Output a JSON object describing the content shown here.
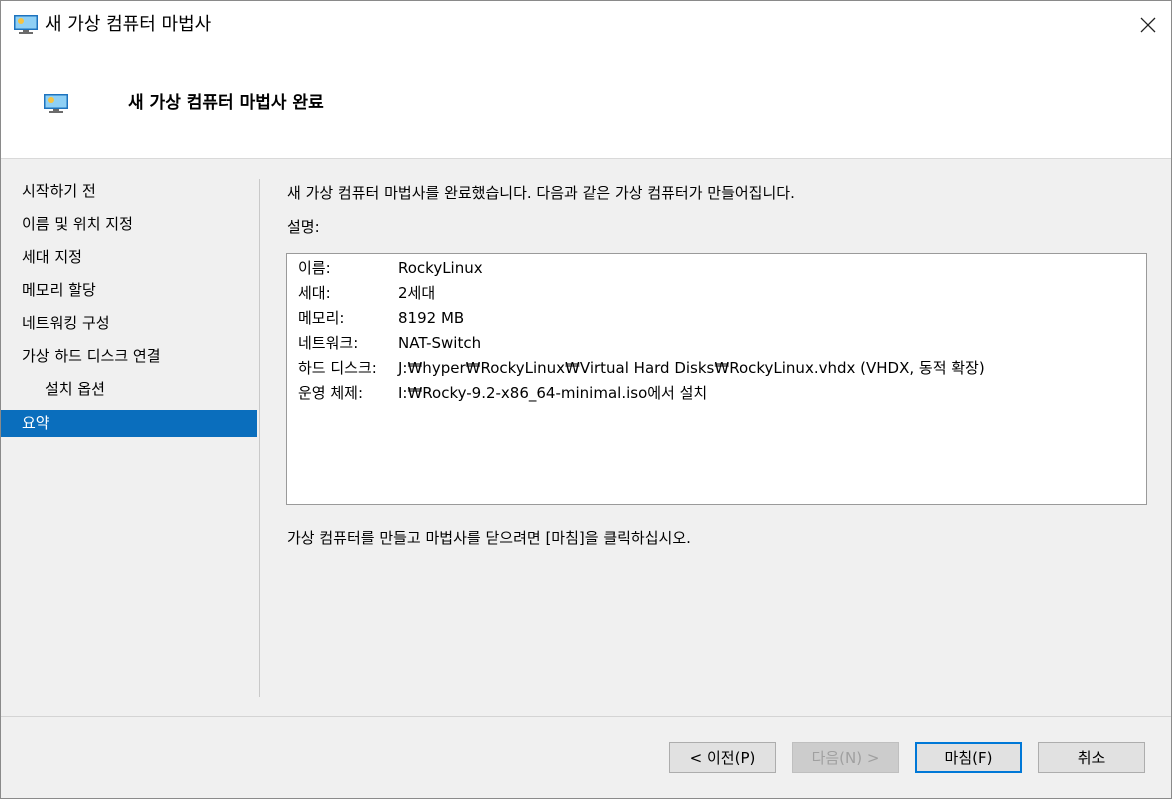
{
  "window": {
    "title": "새 가상 컴퓨터 마법사",
    "close_icon": "close-icon"
  },
  "header": {
    "title": "새 가상 컴퓨터 마법사 완료",
    "icon": "virtual-machine-icon"
  },
  "sidebar": {
    "items": [
      {
        "label": "시작하기 전"
      },
      {
        "label": "이름 및 위치 지정"
      },
      {
        "label": "세대 지정"
      },
      {
        "label": "메모리 할당"
      },
      {
        "label": "네트워킹 구성"
      },
      {
        "label": "가상 하드 디스크 연결"
      },
      {
        "label": "설치 옵션"
      },
      {
        "label": "요약"
      }
    ],
    "selected": "요약",
    "selected_color": "#0a6ebd"
  },
  "main": {
    "intro": "새 가상 컴퓨터 마법사를 완료했습니다. 다음과 같은 가상 컴퓨터가 만들어집니다.",
    "description_label": "설명:",
    "summary": [
      {
        "key": "이름:",
        "value": "RockyLinux"
      },
      {
        "key": "세대:",
        "value": "2세대"
      },
      {
        "key": "메모리:",
        "value": "8192 MB"
      },
      {
        "key": "네트워크:",
        "value": "NAT-Switch"
      },
      {
        "key": "하드 디스크:",
        "value": "J:₩hyper₩RockyLinux₩Virtual Hard Disks₩RockyLinux.vhdx (VHDX, 동적 확장)"
      },
      {
        "key": "운영 체제:",
        "value": "I:₩Rocky-9.2-x86_64-minimal.iso에서 설치"
      }
    ],
    "outro": "가상 컴퓨터를 만들고 마법사를 닫으려면 [마침]을 클릭하십시오."
  },
  "footer": {
    "prev_label": "< 이전(P)",
    "next_label": "다음(N) >",
    "finish_label": "마침(F)",
    "cancel_label": "취소"
  }
}
